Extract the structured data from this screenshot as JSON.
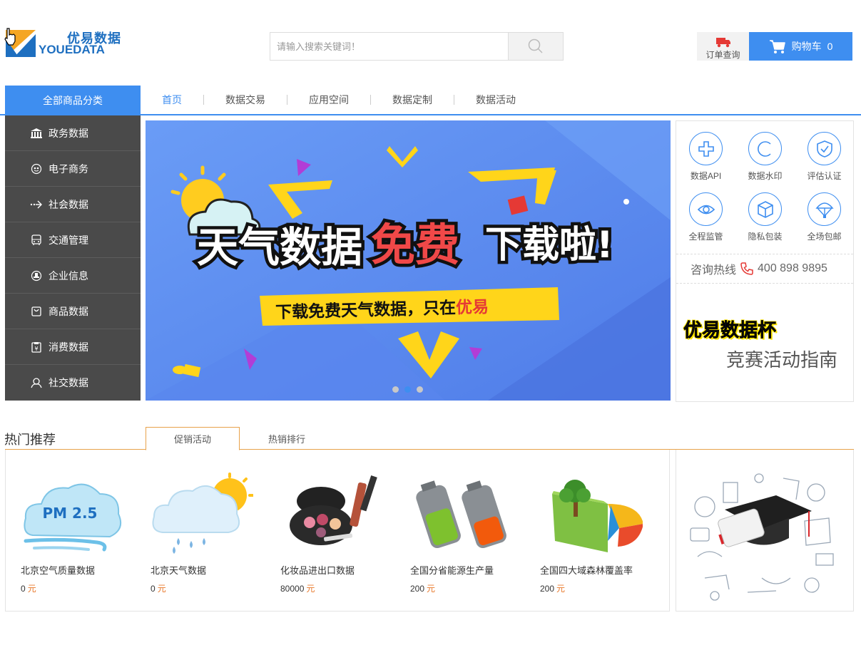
{
  "header": {
    "logo_cn": "优易数据",
    "logo_en": "YOUEDATA",
    "search_placeholder": "请输入搜索关键词！",
    "order_query": "订单查询",
    "cart_label": "购物车",
    "cart_count": "0"
  },
  "nav": {
    "all_categories": "全部商品分类",
    "items": [
      "首页",
      "数据交易",
      "应用空间",
      "数据定制",
      "数据活动"
    ]
  },
  "sidebar": {
    "items": [
      {
        "label": "政务数据",
        "icon": "government-icon"
      },
      {
        "label": "电子商务",
        "icon": "ecommerce-icon"
      },
      {
        "label": "社会数据",
        "icon": "social-data-icon"
      },
      {
        "label": "交通管理",
        "icon": "bus-icon"
      },
      {
        "label": "企业信息",
        "icon": "enterprise-icon"
      },
      {
        "label": "商品数据",
        "icon": "shopping-bag-icon"
      },
      {
        "label": "消费数据",
        "icon": "consumption-icon"
      },
      {
        "label": "社交数据",
        "icon": "social-network-icon"
      }
    ]
  },
  "banner": {
    "title_part1": "天气数据",
    "title_part2": "免费",
    "title_part3": "下载啦!",
    "subtitle_main": "下载免费天气数据，只在",
    "subtitle_brand": "优易",
    "slide_count": 3,
    "active_slide": 2
  },
  "services": {
    "items": [
      {
        "label": "数据API",
        "icon": "api-icon"
      },
      {
        "label": "数据水印",
        "icon": "watermark-icon"
      },
      {
        "label": "评估认证",
        "icon": "shield-check-icon"
      },
      {
        "label": "全程监管",
        "icon": "eye-icon"
      },
      {
        "label": "隐私包装",
        "icon": "package-icon"
      },
      {
        "label": "全场包邮",
        "icon": "parachute-icon"
      }
    ],
    "hotline_label": "咨询热线",
    "hotline_number": "400 898 9895",
    "contest_title": "优易数据杯",
    "contest_subtitle": "竞赛活动指南"
  },
  "hot": {
    "title": "热门推荐",
    "tabs": [
      "促销活动",
      "热销排行"
    ],
    "currency": "元",
    "products": [
      {
        "name": "北京空气质量数据",
        "price": "0",
        "image": "pm25-cloud-image",
        "pm_text": "PM 2.5"
      },
      {
        "name": "北京天气数据",
        "price": "0",
        "image": "weather-cloud-image"
      },
      {
        "name": "化妆品进出口数据",
        "price": "80000",
        "image": "cosmetics-image"
      },
      {
        "name": "全国分省能源生产量",
        "price": "200",
        "image": "batteries-image"
      },
      {
        "name": "全国四大域森林覆盖率",
        "price": "200",
        "image": "forest-pie-image"
      }
    ]
  }
}
